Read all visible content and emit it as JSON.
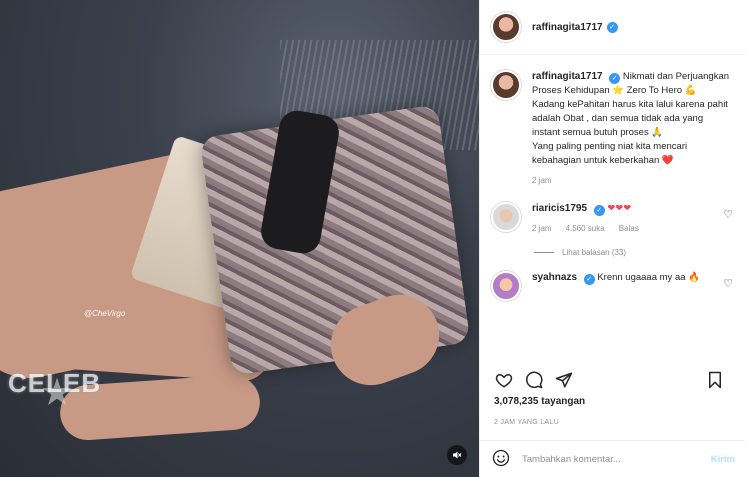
{
  "media": {
    "watermark": "@CheVirgo",
    "logo_text": "CELEB"
  },
  "post": {
    "username": "raffinagita1717",
    "caption": {
      "username": "raffinagita1717",
      "lines": [
        "Nikmati dan Perjuangkan Proses Kehidupan ⭐ Zero To Hero 💪",
        "Kadang kePahitan harus kita lalui karena pahit adalah Obat , dan semua tidak ada yang instant semua butuh proses 🙏",
        "Yang paling penting niat kita mencari kebahagian untuk keberkahan ❤️"
      ],
      "time": "2 jam"
    },
    "comments": [
      {
        "username": "riaricis1795",
        "text": "❤❤❤",
        "time": "2 jam",
        "likes": "4.560 suka",
        "reply_label": "Balas",
        "view_replies": "Lihat balasan (33)"
      },
      {
        "username": "syahnazs",
        "text": "Krenn ugaaaa my aa 🔥"
      }
    ],
    "views": "3,078,235 tayangan",
    "posted_ago": "2 JAM YANG LALU",
    "add_comment_placeholder": "Tambahkan komentar...",
    "post_button": "Kirim"
  },
  "colors": {
    "verified": "#3897f0",
    "heart_red": "#ed4956",
    "post_button_disabled": "#b2dffc"
  }
}
